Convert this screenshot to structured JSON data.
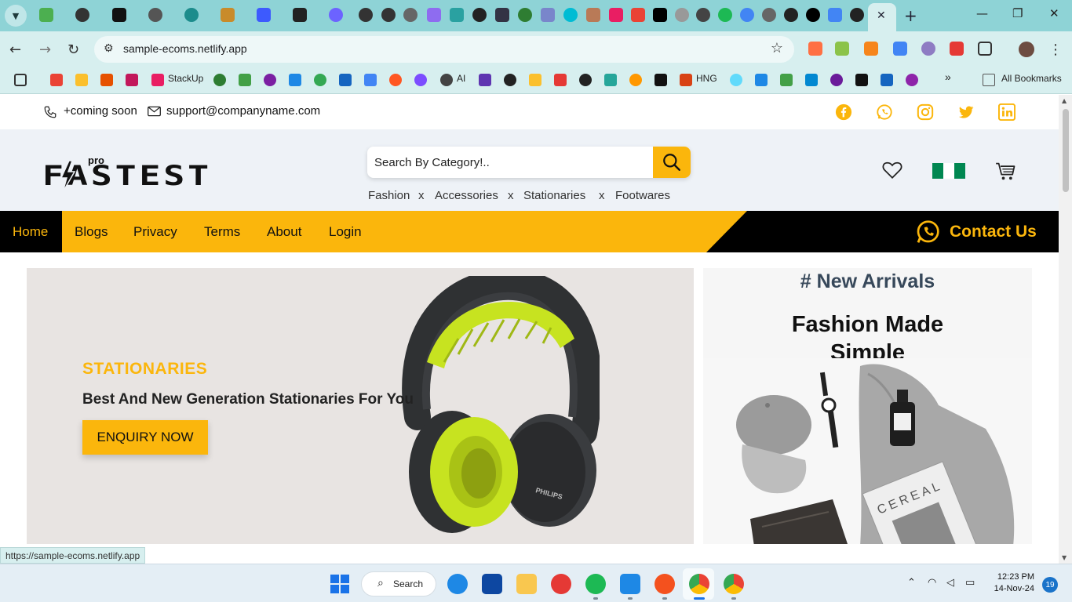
{
  "browser": {
    "url": "sample-ecoms.netlify.app",
    "bookmarks": [
      {
        "label": "StackUp"
      },
      {
        "label": "AI"
      },
      {
        "label": "HNG"
      }
    ],
    "all_bookmarks_label": "All Bookmarks",
    "status_url": "https://sample-ecoms.netlify.app"
  },
  "site": {
    "topbar": {
      "phone": "+coming soon",
      "email": "support@companyname.com"
    },
    "logo_small": "pro",
    "logo_text": "FASTEST",
    "search": {
      "placeholder": "Search By Category!.."
    },
    "categories": [
      "Fashion",
      "Accessories",
      "Stationaries",
      "Footwares"
    ],
    "category_separator": "x",
    "nav": {
      "items": [
        "Home",
        "Blogs",
        "Privacy",
        "Terms",
        "About",
        "Login"
      ],
      "contact_label": "Contact Us"
    },
    "hero": {
      "kicker": "STATIONARIES",
      "headline": "Best And New Generation Stationaries For You",
      "cta": "ENQUIRY NOW",
      "product_brand": "PHILIPS"
    },
    "side": {
      "tag": "# New Arrivals",
      "title_line1": "Fashion Made",
      "title_line2": "Simple",
      "magazine_text": "CEREAL"
    },
    "colors": {
      "accent": "#fbb60c",
      "nav_dark": "#000000",
      "header_bg": "#eef2f7"
    }
  },
  "taskbar": {
    "search_label": "Search",
    "time": "12:23 PM",
    "date": "14-Nov-24",
    "notifications": "19"
  }
}
